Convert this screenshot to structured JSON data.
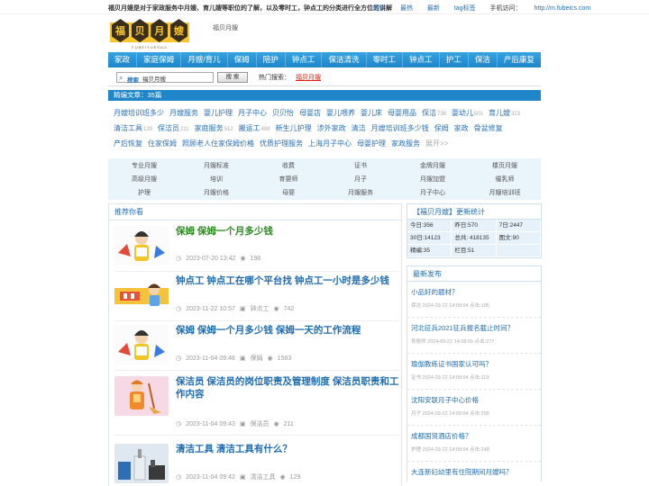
{
  "topbar": {
    "intro": "福贝月嫂是对于家政服务中月嫂、育儿嫂等职位的了解，以及零时工，钟点工的分类进行全方位的讲解",
    "links": [
      "图文",
      "最热",
      "最新",
      "tag标签"
    ],
    "mobile_label": "手机访问：",
    "mobile_url": "http://m.fubeics.com"
  },
  "header": {
    "logo_chars": [
      "福",
      "贝",
      "月",
      "嫂"
    ],
    "logo_sub": "FUBEIYUESAO",
    "crumb": "福贝月嫂"
  },
  "nav": [
    "家政",
    "家庭保姆",
    "月嫂/育儿",
    "保姆",
    "陪护",
    "钟点工",
    "保洁清洗",
    "零时工",
    "钟点工",
    "护工",
    "保洁",
    "产后康复"
  ],
  "search": {
    "label": "搜索",
    "value": "福贝月嫂",
    "button": "搜 索",
    "hot_label": "热门搜索：",
    "hot_keyword": "福贝月嫂"
  },
  "section": {
    "title": "精编文章：35篇"
  },
  "tags": [
    {
      "t": "月嫂培训班多少",
      "n": ""
    },
    {
      "t": "月嫂服务",
      "n": ""
    },
    {
      "t": "婴儿护理",
      "n": ""
    },
    {
      "t": "月子中心",
      "n": ""
    },
    {
      "t": "贝贝怡",
      "n": ""
    },
    {
      "t": "母婴店",
      "n": ""
    },
    {
      "t": "婴儿喂养",
      "n": ""
    },
    {
      "t": "婴儿床",
      "n": ""
    },
    {
      "t": "母婴用品",
      "n": ""
    },
    {
      "t": "保洁",
      "n": "736"
    },
    {
      "t": "婴幼儿",
      "n": "501"
    },
    {
      "t": "育儿嫂",
      "n": "323"
    },
    {
      "t": "清洁工具",
      "n": "129"
    },
    {
      "t": "保洁员",
      "n": "211"
    },
    {
      "t": "家庭服务",
      "n": "512"
    },
    {
      "t": "搬运工",
      "n": "488"
    },
    {
      "t": "新生儿护理",
      "n": ""
    },
    {
      "t": "涉外家政",
      "n": ""
    },
    {
      "t": "清洁",
      "n": ""
    },
    {
      "t": "月嫂培训班多少钱",
      "n": ""
    },
    {
      "t": "保姆",
      "n": ""
    },
    {
      "t": "家政",
      "n": ""
    },
    {
      "t": "骨盆修复",
      "n": ""
    },
    {
      "t": "产后恢复",
      "n": ""
    },
    {
      "t": "住家保姆",
      "n": ""
    },
    {
      "t": "照顾老人住家保姆价格",
      "n": ""
    },
    {
      "t": "优质护理服务",
      "n": ""
    },
    {
      "t": "上海月子中心",
      "n": ""
    },
    {
      "t": "母婴护理",
      "n": ""
    },
    {
      "t": "家政服务",
      "n": ""
    }
  ],
  "tags_more": "展开>>",
  "grid": [
    [
      "专业月嫂",
      "月嫂标准",
      "收费",
      "证书",
      "金牌月嫂",
      "楼页月嫂"
    ],
    [
      "高级月嫂",
      "培训",
      "育婴师",
      "月子",
      "月嫂加盟",
      "催乳师"
    ],
    [
      "护理",
      "月嫂价格",
      "母婴",
      "月嫂服务",
      "月子中心",
      "月嫂培训班"
    ]
  ],
  "recommend": {
    "title": "推荐你看",
    "articles": [
      {
        "title": "保姆 保姆一个月多少钱",
        "date": "2023-07-20 13:42",
        "category": "",
        "views": "198",
        "thumb": "nanny",
        "green": true
      },
      {
        "title": "钟点工 钟点工在哪个平台找 钟点工一小时是多少钱",
        "date": "2023-11-22 10:57",
        "category": "钟点工",
        "views": "742",
        "thumb": "hourly",
        "green": false
      },
      {
        "title": "保姆 保姆一个月多少钱 保姆一天的工作流程",
        "date": "2023-11-04 09:46",
        "category": "保姆",
        "views": "1583",
        "thumb": "nanny",
        "green": false
      },
      {
        "title": "保洁员 保洁员的岗位职责及管理制度 保洁员职责和工作内容",
        "date": "2023-11-04 09:43",
        "category": "保洁员",
        "views": "211",
        "thumb": "cleaner",
        "green": false
      },
      {
        "title": "清洁工具 清洁工具有什么？",
        "date": "2023-11-04 09:42",
        "category": "清洁工具",
        "views": "129",
        "thumb": "tools",
        "green": false
      }
    ]
  },
  "stats": {
    "title": "【福贝月嫂】更新统计",
    "rows": [
      [
        "今日:356",
        "昨日:570",
        "7日:2447"
      ],
      [
        "30日:14123",
        "总共: 418135",
        "图文:90"
      ],
      [
        "精编:35",
        "栏目:51",
        ""
      ]
    ]
  },
  "latest": {
    "title": "最新发布",
    "items": [
      {
        "q": "小品好的题材？",
        "m": "保洁 2024-09-22 14:09:04  点击:185"
      },
      {
        "q": "河北征兵2021征兵报名截止时间？",
        "m": "育婴师 2024-09-22 14:09:05  点击:277"
      },
      {
        "q": "瑜伽教练证书国家认可吗？",
        "m": "证书 2024-09-22 14:09:04  点击:119"
      },
      {
        "q": "沈阳安联月子中心价格",
        "m": "月子 2024-09-22 14:09:04  点击:295"
      },
      {
        "q": "成都国贸酒店价格？",
        "m": "护理 2024-09-22 14:09:04  点击:248"
      },
      {
        "q": "大连新妇幼里有住院期间月嫂吗？",
        "m": ""
      }
    ]
  }
}
